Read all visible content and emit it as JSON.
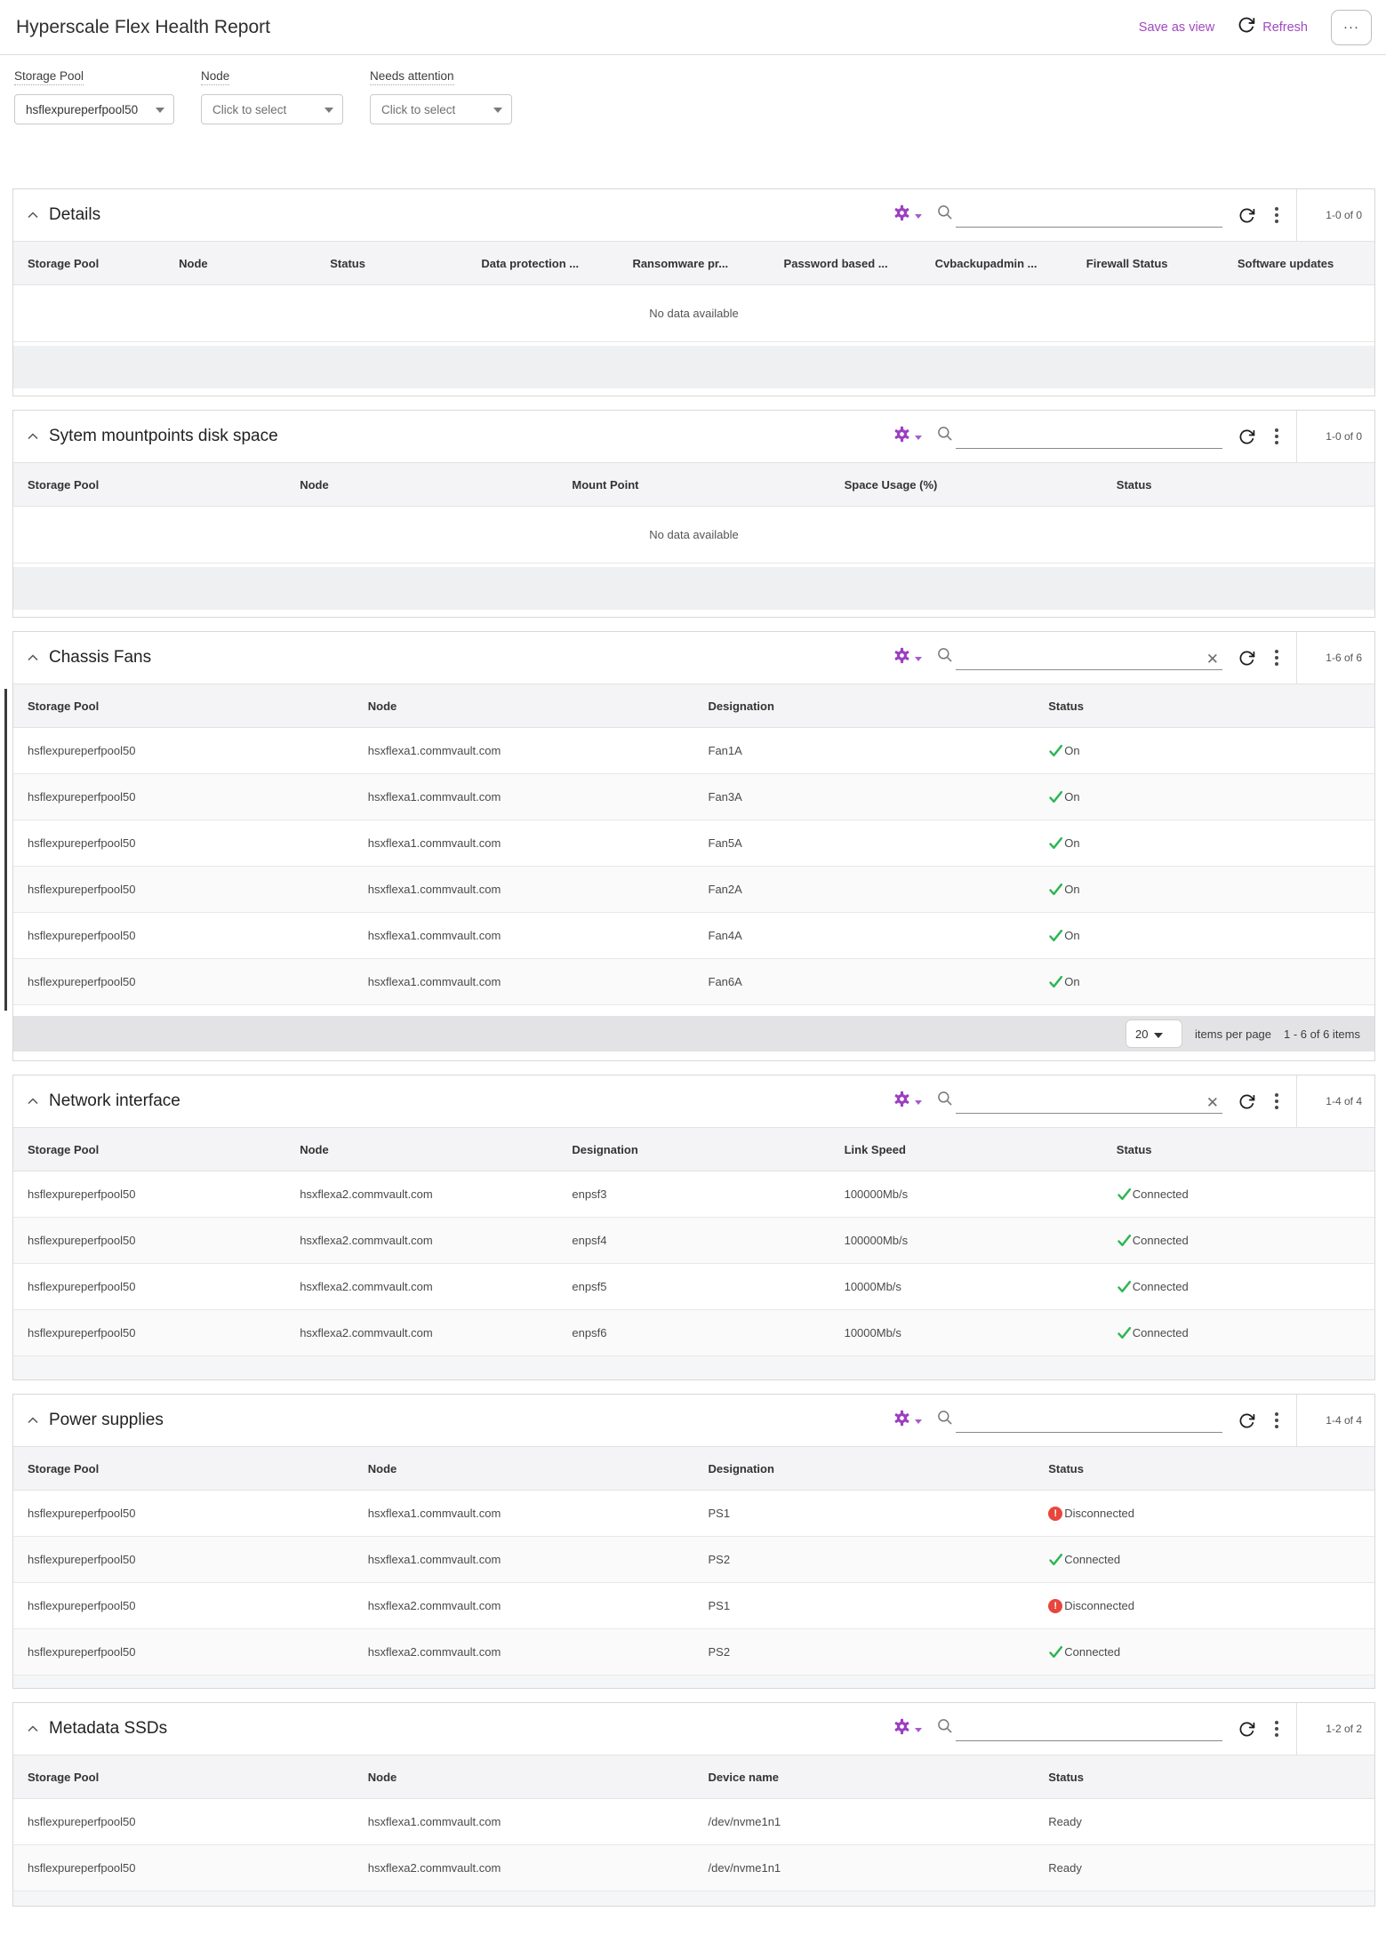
{
  "app": {
    "title": "Hyperscale Flex Health Report",
    "save_as_view": "Save as view",
    "refresh": "Refresh",
    "more": "···"
  },
  "filters": {
    "storage_pool": {
      "label": "Storage Pool",
      "value": "hsflexpureperfpool50"
    },
    "node": {
      "label": "Node",
      "placeholder": "Click to select"
    },
    "needs_attention": {
      "label": "Needs attention",
      "placeholder": "Click to select"
    }
  },
  "common": {
    "no_data": "No data available"
  },
  "colors": {
    "accent_purple": "#a148c0",
    "status_green": "#2db553",
    "status_red": "#e8463c"
  },
  "sections": [
    {
      "title": "Details",
      "count": "1-0 of 0",
      "columns": [
        "Storage Pool",
        "Node",
        "Status",
        "Data protection ...",
        "Ransomware pr...",
        "Password based ...",
        "Cvbackupadmin ...",
        "Firewall Status",
        "Software updates"
      ],
      "rows": []
    },
    {
      "title": "Sytem mountpoints disk space",
      "count": "1-0 of 0",
      "columns": [
        "Storage Pool",
        "Node",
        "Mount Point",
        "Space Usage (%)",
        "Status"
      ],
      "rows": []
    },
    {
      "title": "Chassis Fans",
      "count": "1-6 of 6",
      "columns": [
        "Storage Pool",
        "Node",
        "Designation",
        "Status"
      ],
      "rows": [
        [
          "hsflexpureperfpool50",
          "hsxflexa1.commvault.com",
          "Fan1A",
          {
            "icon": "check",
            "text": "On"
          }
        ],
        [
          "hsflexpureperfpool50",
          "hsxflexa1.commvault.com",
          "Fan3A",
          {
            "icon": "check",
            "text": "On"
          }
        ],
        [
          "hsflexpureperfpool50",
          "hsxflexa1.commvault.com",
          "Fan5A",
          {
            "icon": "check",
            "text": "On"
          }
        ],
        [
          "hsflexpureperfpool50",
          "hsxflexa1.commvault.com",
          "Fan2A",
          {
            "icon": "check",
            "text": "On"
          }
        ],
        [
          "hsflexpureperfpool50",
          "hsxflexa1.commvault.com",
          "Fan4A",
          {
            "icon": "check",
            "text": "On"
          }
        ],
        [
          "hsflexpureperfpool50",
          "hsxflexa1.commvault.com",
          "Fan6A",
          {
            "icon": "check",
            "text": "On"
          }
        ]
      ],
      "pagination": {
        "page_size": "20",
        "label": "items per page",
        "range": "1 - 6 of 6 items"
      }
    },
    {
      "title": "Network interface",
      "count": "1-4 of 4",
      "columns": [
        "Storage Pool",
        "Node",
        "Designation",
        "Link Speed",
        "Status"
      ],
      "rows": [
        [
          "hsflexpureperfpool50",
          "hsxflexa2.commvault.com",
          "enpsf3",
          "100000Mb/s",
          {
            "icon": "check",
            "text": "Connected"
          }
        ],
        [
          "hsflexpureperfpool50",
          "hsxflexa2.commvault.com",
          "enpsf4",
          "100000Mb/s",
          {
            "icon": "check",
            "text": "Connected"
          }
        ],
        [
          "hsflexpureperfpool50",
          "hsxflexa2.commvault.com",
          "enpsf5",
          "10000Mb/s",
          {
            "icon": "check",
            "text": "Connected"
          }
        ],
        [
          "hsflexpureperfpool50",
          "hsxflexa2.commvault.com",
          "enpsf6",
          "10000Mb/s",
          {
            "icon": "check",
            "text": "Connected"
          }
        ]
      ]
    },
    {
      "title": "Power supplies",
      "count": "1-4 of 4",
      "columns": [
        "Storage Pool",
        "Node",
        "Designation",
        "Status"
      ],
      "rows": [
        [
          "hsflexpureperfpool50",
          "hsxflexa1.commvault.com",
          "PS1",
          {
            "icon": "alert",
            "text": "Disconnected"
          }
        ],
        [
          "hsflexpureperfpool50",
          "hsxflexa1.commvault.com",
          "PS2",
          {
            "icon": "check",
            "text": "Connected"
          }
        ],
        [
          "hsflexpureperfpool50",
          "hsxflexa2.commvault.com",
          "PS1",
          {
            "icon": "alert",
            "text": "Disconnected"
          }
        ],
        [
          "hsflexpureperfpool50",
          "hsxflexa2.commvault.com",
          "PS2",
          {
            "icon": "check",
            "text": "Connected"
          }
        ]
      ]
    },
    {
      "title": "Metadata SSDs",
      "count": "1-2 of 2",
      "columns": [
        "Storage Pool",
        "Node",
        "Device name",
        "Status"
      ],
      "rows": [
        [
          "hsflexpureperfpool50",
          "hsxflexa1.commvault.com",
          "/dev/nvme1n1",
          "Ready"
        ],
        [
          "hsflexpureperfpool50",
          "hsxflexa2.commvault.com",
          "/dev/nvme1n1",
          "Ready"
        ]
      ]
    }
  ]
}
